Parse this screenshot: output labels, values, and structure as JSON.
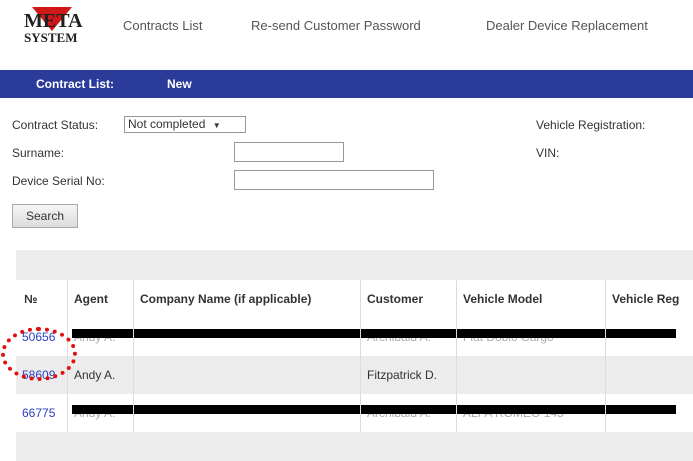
{
  "logo": {
    "line1": "META",
    "line2": "SYSTEM"
  },
  "nav": {
    "links": [
      "Contracts List",
      "Re-send Customer Password",
      "Dealer Device Replacement"
    ]
  },
  "bar": {
    "items": [
      "Contract List:",
      "New"
    ]
  },
  "filters": {
    "status_label": "Contract Status:",
    "status_value": "Not completed",
    "surname_label": "Surname:",
    "serial_label": "Device Serial No:",
    "vehicle_reg_label": "Vehicle Registration:",
    "vin_label": "VIN:",
    "search_button": "Search"
  },
  "table": {
    "columns": [
      "№",
      "Agent",
      "Company Name (if applicable)",
      "Customer",
      "Vehicle Model",
      "Vehicle Reg"
    ],
    "rows": [
      {
        "number": "50656",
        "agent": "Andy A.",
        "company": "",
        "customer": "Archibald A.",
        "model": "Fiat Doblo Cargo",
        "reg": "",
        "redacted": true
      },
      {
        "number": "58609",
        "agent": "Andy A.",
        "company": "",
        "customer": "Fitzpatrick D.",
        "model": "",
        "reg": "",
        "redacted": false
      },
      {
        "number": "66775",
        "agent": "Andy A.",
        "company": "",
        "customer": "Archibald A.",
        "model": "ALFA ROMEO 145",
        "reg": "",
        "redacted": true
      }
    ]
  },
  "colors": {
    "nav_bar": "#2b3b9a",
    "link": "#2a3fbf",
    "highlight": "#e01010",
    "logo_red": "#d01818"
  }
}
